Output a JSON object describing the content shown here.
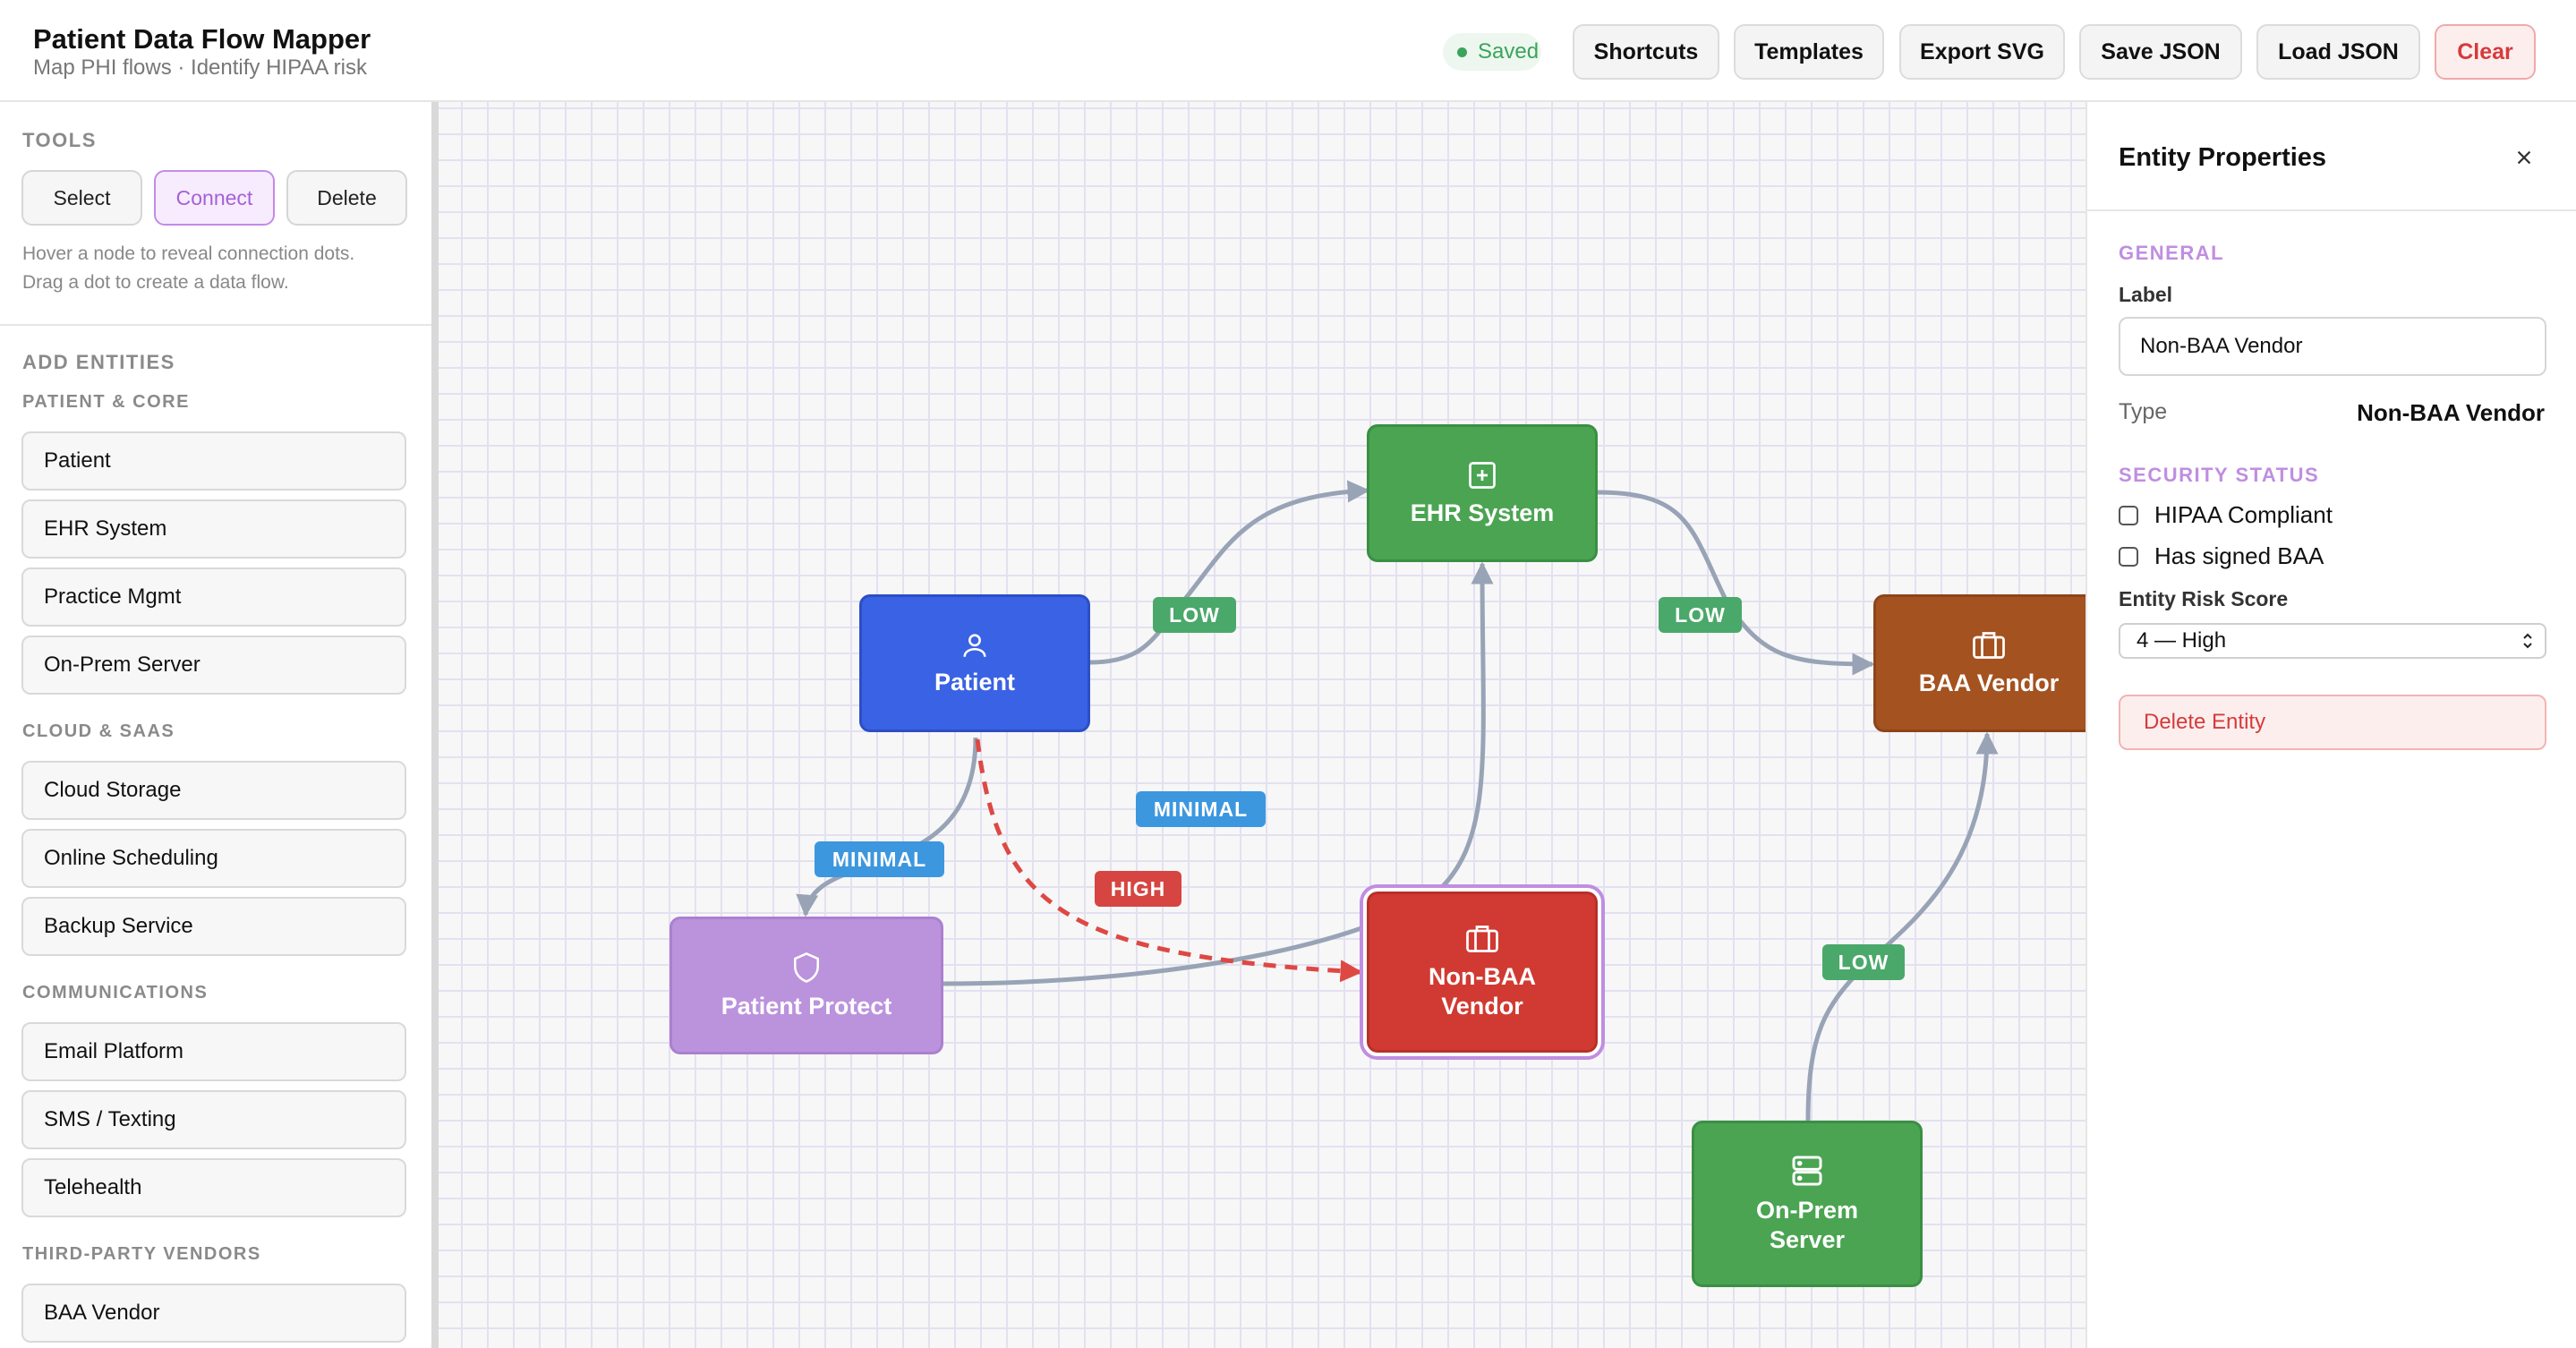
{
  "header": {
    "title": "Patient Data Flow Mapper",
    "subtitle": "Map PHI flows · Identify HIPAA risk",
    "saved_status": "Saved",
    "buttons": {
      "shortcuts": "Shortcuts",
      "templates": "Templates",
      "export_svg": "Export SVG",
      "save_json": "Save JSON",
      "load_json": "Load JSON",
      "clear": "Clear"
    }
  },
  "sidebar": {
    "tools_title": "TOOLS",
    "tools": {
      "select": "Select",
      "connect": "Connect",
      "delete": "Delete"
    },
    "active_tool": "Connect",
    "hint_line1": "Hover a node to reveal connection dots.",
    "hint_line2": "Drag a dot to create a data flow.",
    "add_entities_title": "ADD ENTITIES",
    "groups": {
      "patient_core": {
        "title": "PATIENT & CORE",
        "items": [
          "Patient",
          "EHR System",
          "Practice Mgmt",
          "On-Prem Server"
        ]
      },
      "cloud_saas": {
        "title": "CLOUD & SAAS",
        "items": [
          "Cloud Storage",
          "Online Scheduling",
          "Backup Service"
        ]
      },
      "communications": {
        "title": "COMMUNICATIONS",
        "items": [
          "Email Platform",
          "SMS / Texting",
          "Telehealth"
        ]
      },
      "third_party": {
        "title": "THIRD-PARTY VENDORS",
        "items": [
          "BAA Vendor"
        ]
      }
    }
  },
  "canvas": {
    "nodes": {
      "patient": {
        "line1": "Patient",
        "line2": "",
        "icon": "user-icon",
        "color": "#3a62e4"
      },
      "ehr": {
        "line1": "EHR System",
        "line2": "",
        "icon": "medical-plus-icon",
        "color": "#4aa452"
      },
      "baa_vendor": {
        "line1": "BAA Vendor",
        "line2": "",
        "icon": "briefcase-icon",
        "color": "#a45220"
      },
      "patient_protect": {
        "line1": "Patient Protect",
        "line2": "",
        "icon": "shield-icon",
        "color": "#bb92dc"
      },
      "non_baa": {
        "line1": "Non-BAA",
        "line2": "Vendor",
        "icon": "briefcase-icon",
        "color": "#d03a32"
      },
      "onprem": {
        "line1": "On-Prem",
        "line2": "Server",
        "icon": "server-icon",
        "color": "#4aa452"
      }
    },
    "edge_labels": {
      "patient_ehr": "LOW",
      "ehr_baa": "LOW",
      "protect_ehr": "MINIMAL",
      "patient_protect": "MINIMAL",
      "patient_nonbaa": "HIGH",
      "onprem_baa": "LOW"
    },
    "risk_colors": {
      "low": "#4aa86a",
      "minimal": "#3d97de",
      "high": "#d64541"
    }
  },
  "properties": {
    "title": "Entity Properties",
    "general_title": "GENERAL",
    "label_title": "Label",
    "label_value": "Non-BAA Vendor",
    "type_key": "Type",
    "type_value": "Non-BAA Vendor",
    "security_title": "SECURITY STATUS",
    "hipaa_label": "HIPAA Compliant",
    "hipaa_checked": false,
    "baa_label": "Has signed BAA",
    "baa_checked": false,
    "risk_title": "Entity Risk Score",
    "risk_value": "4 — High",
    "delete_label": "Delete Entity"
  }
}
